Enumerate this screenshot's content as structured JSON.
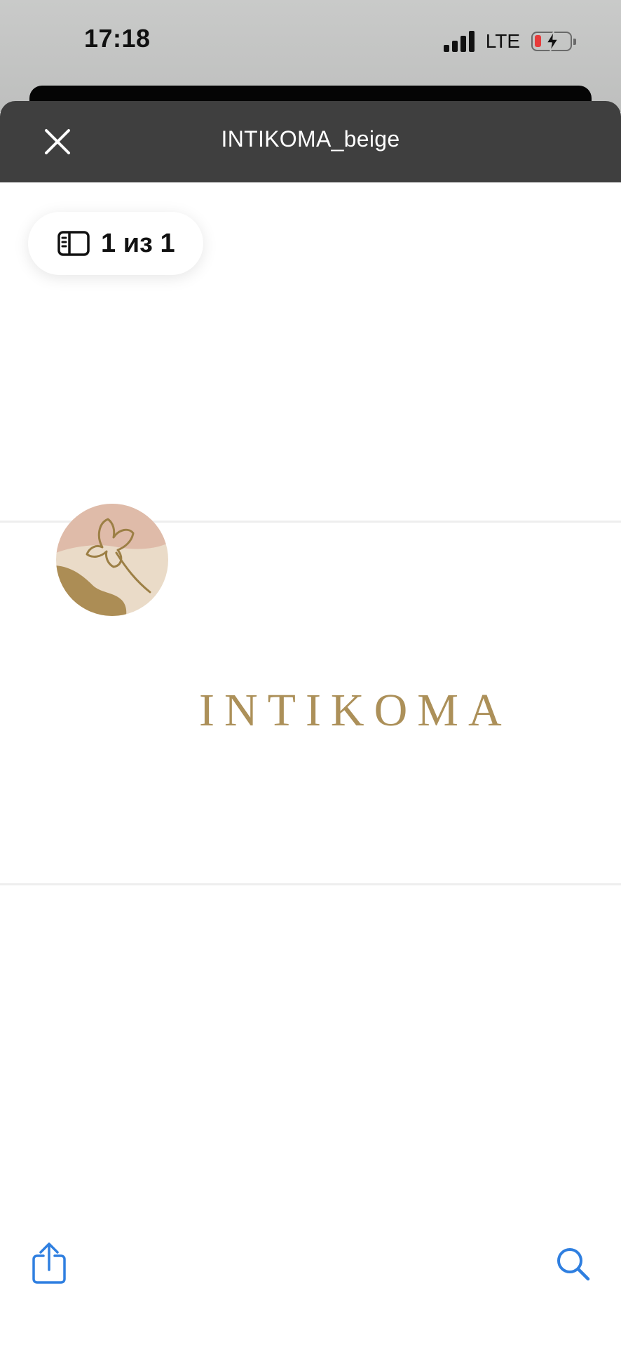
{
  "status_bar": {
    "time": "17:18",
    "network": "LTE"
  },
  "header": {
    "title": "INTIKOMA_beige",
    "close_icon": "close-icon"
  },
  "page_counter": {
    "icon": "sidebar-icon",
    "label": "1 из 1"
  },
  "document": {
    "logo_icon": "intikoma-logo-icon"
  },
  "toolbar": {
    "share_icon": "share-icon",
    "search_icon": "search-icon"
  },
  "colors": {
    "header_bg": "#3f3f3f",
    "accent_blue": "#2f7fe0",
    "logo_gold": "#ac9059",
    "logo_pink": "#dfbcaa",
    "logo_cream": "#ead9c5"
  }
}
